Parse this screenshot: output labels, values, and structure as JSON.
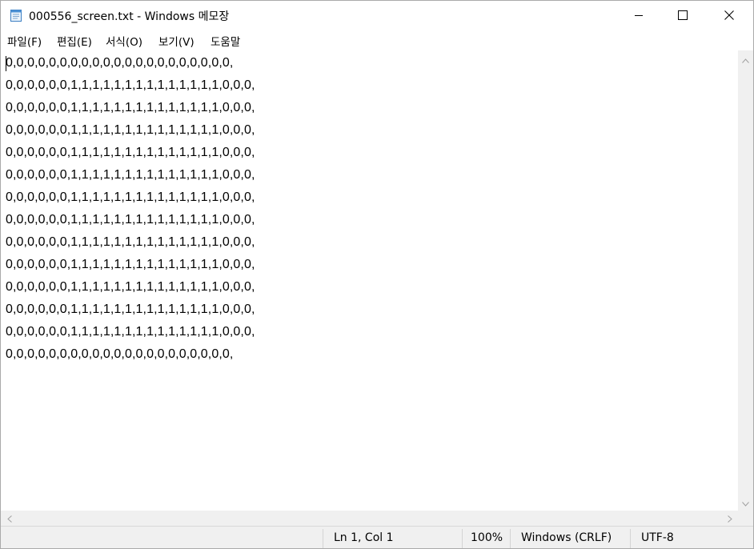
{
  "window": {
    "title": "000556_screen.txt - Windows 메모장",
    "app_icon": "notepad-icon",
    "controls": {
      "minimize_icon": "minimize-icon",
      "maximize_icon": "maximize-icon",
      "close_icon": "close-icon"
    }
  },
  "menu": {
    "items": [
      {
        "label": "파일(F)"
      },
      {
        "label": "편집(E)"
      },
      {
        "label": "서식(O)"
      },
      {
        "label": "보기(V)"
      },
      {
        "label": "도움말"
      }
    ]
  },
  "editor": {
    "lines": [
      "0,0,0,0,0,0,0,0,0,0,0,0,0,0,0,0,0,0,0,0,0,",
      "0,0,0,0,0,0,1,1,1,1,1,1,1,1,1,1,1,1,1,1,0,0,0,",
      "0,0,0,0,0,0,1,1,1,1,1,1,1,1,1,1,1,1,1,1,0,0,0,",
      "0,0,0,0,0,0,1,1,1,1,1,1,1,1,1,1,1,1,1,1,0,0,0,",
      "0,0,0,0,0,0,1,1,1,1,1,1,1,1,1,1,1,1,1,1,0,0,0,",
      "0,0,0,0,0,0,1,1,1,1,1,1,1,1,1,1,1,1,1,1,0,0,0,",
      "0,0,0,0,0,0,1,1,1,1,1,1,1,1,1,1,1,1,1,1,0,0,0,",
      "0,0,0,0,0,0,1,1,1,1,1,1,1,1,1,1,1,1,1,1,0,0,0,",
      "0,0,0,0,0,0,1,1,1,1,1,1,1,1,1,1,1,1,1,1,0,0,0,",
      "0,0,0,0,0,0,1,1,1,1,1,1,1,1,1,1,1,1,1,1,0,0,0,",
      "0,0,0,0,0,0,1,1,1,1,1,1,1,1,1,1,1,1,1,1,0,0,0,",
      "0,0,0,0,0,0,1,1,1,1,1,1,1,1,1,1,1,1,1,1,0,0,0,",
      "0,0,0,0,0,0,1,1,1,1,1,1,1,1,1,1,1,1,1,1,0,0,0,",
      "0,0,0,0,0,0,0,0,0,0,0,0,0,0,0,0,0,0,0,0,0,"
    ]
  },
  "scrollbars": {
    "up_icon": "scroll-up-arrow-icon",
    "down_icon": "scroll-down-arrow-icon",
    "left_icon": "scroll-left-arrow-icon",
    "right_icon": "scroll-right-arrow-icon"
  },
  "status": {
    "position": "Ln 1, Col 1",
    "zoom": "100%",
    "line_ending": "Windows (CRLF)",
    "encoding": "UTF-8"
  }
}
